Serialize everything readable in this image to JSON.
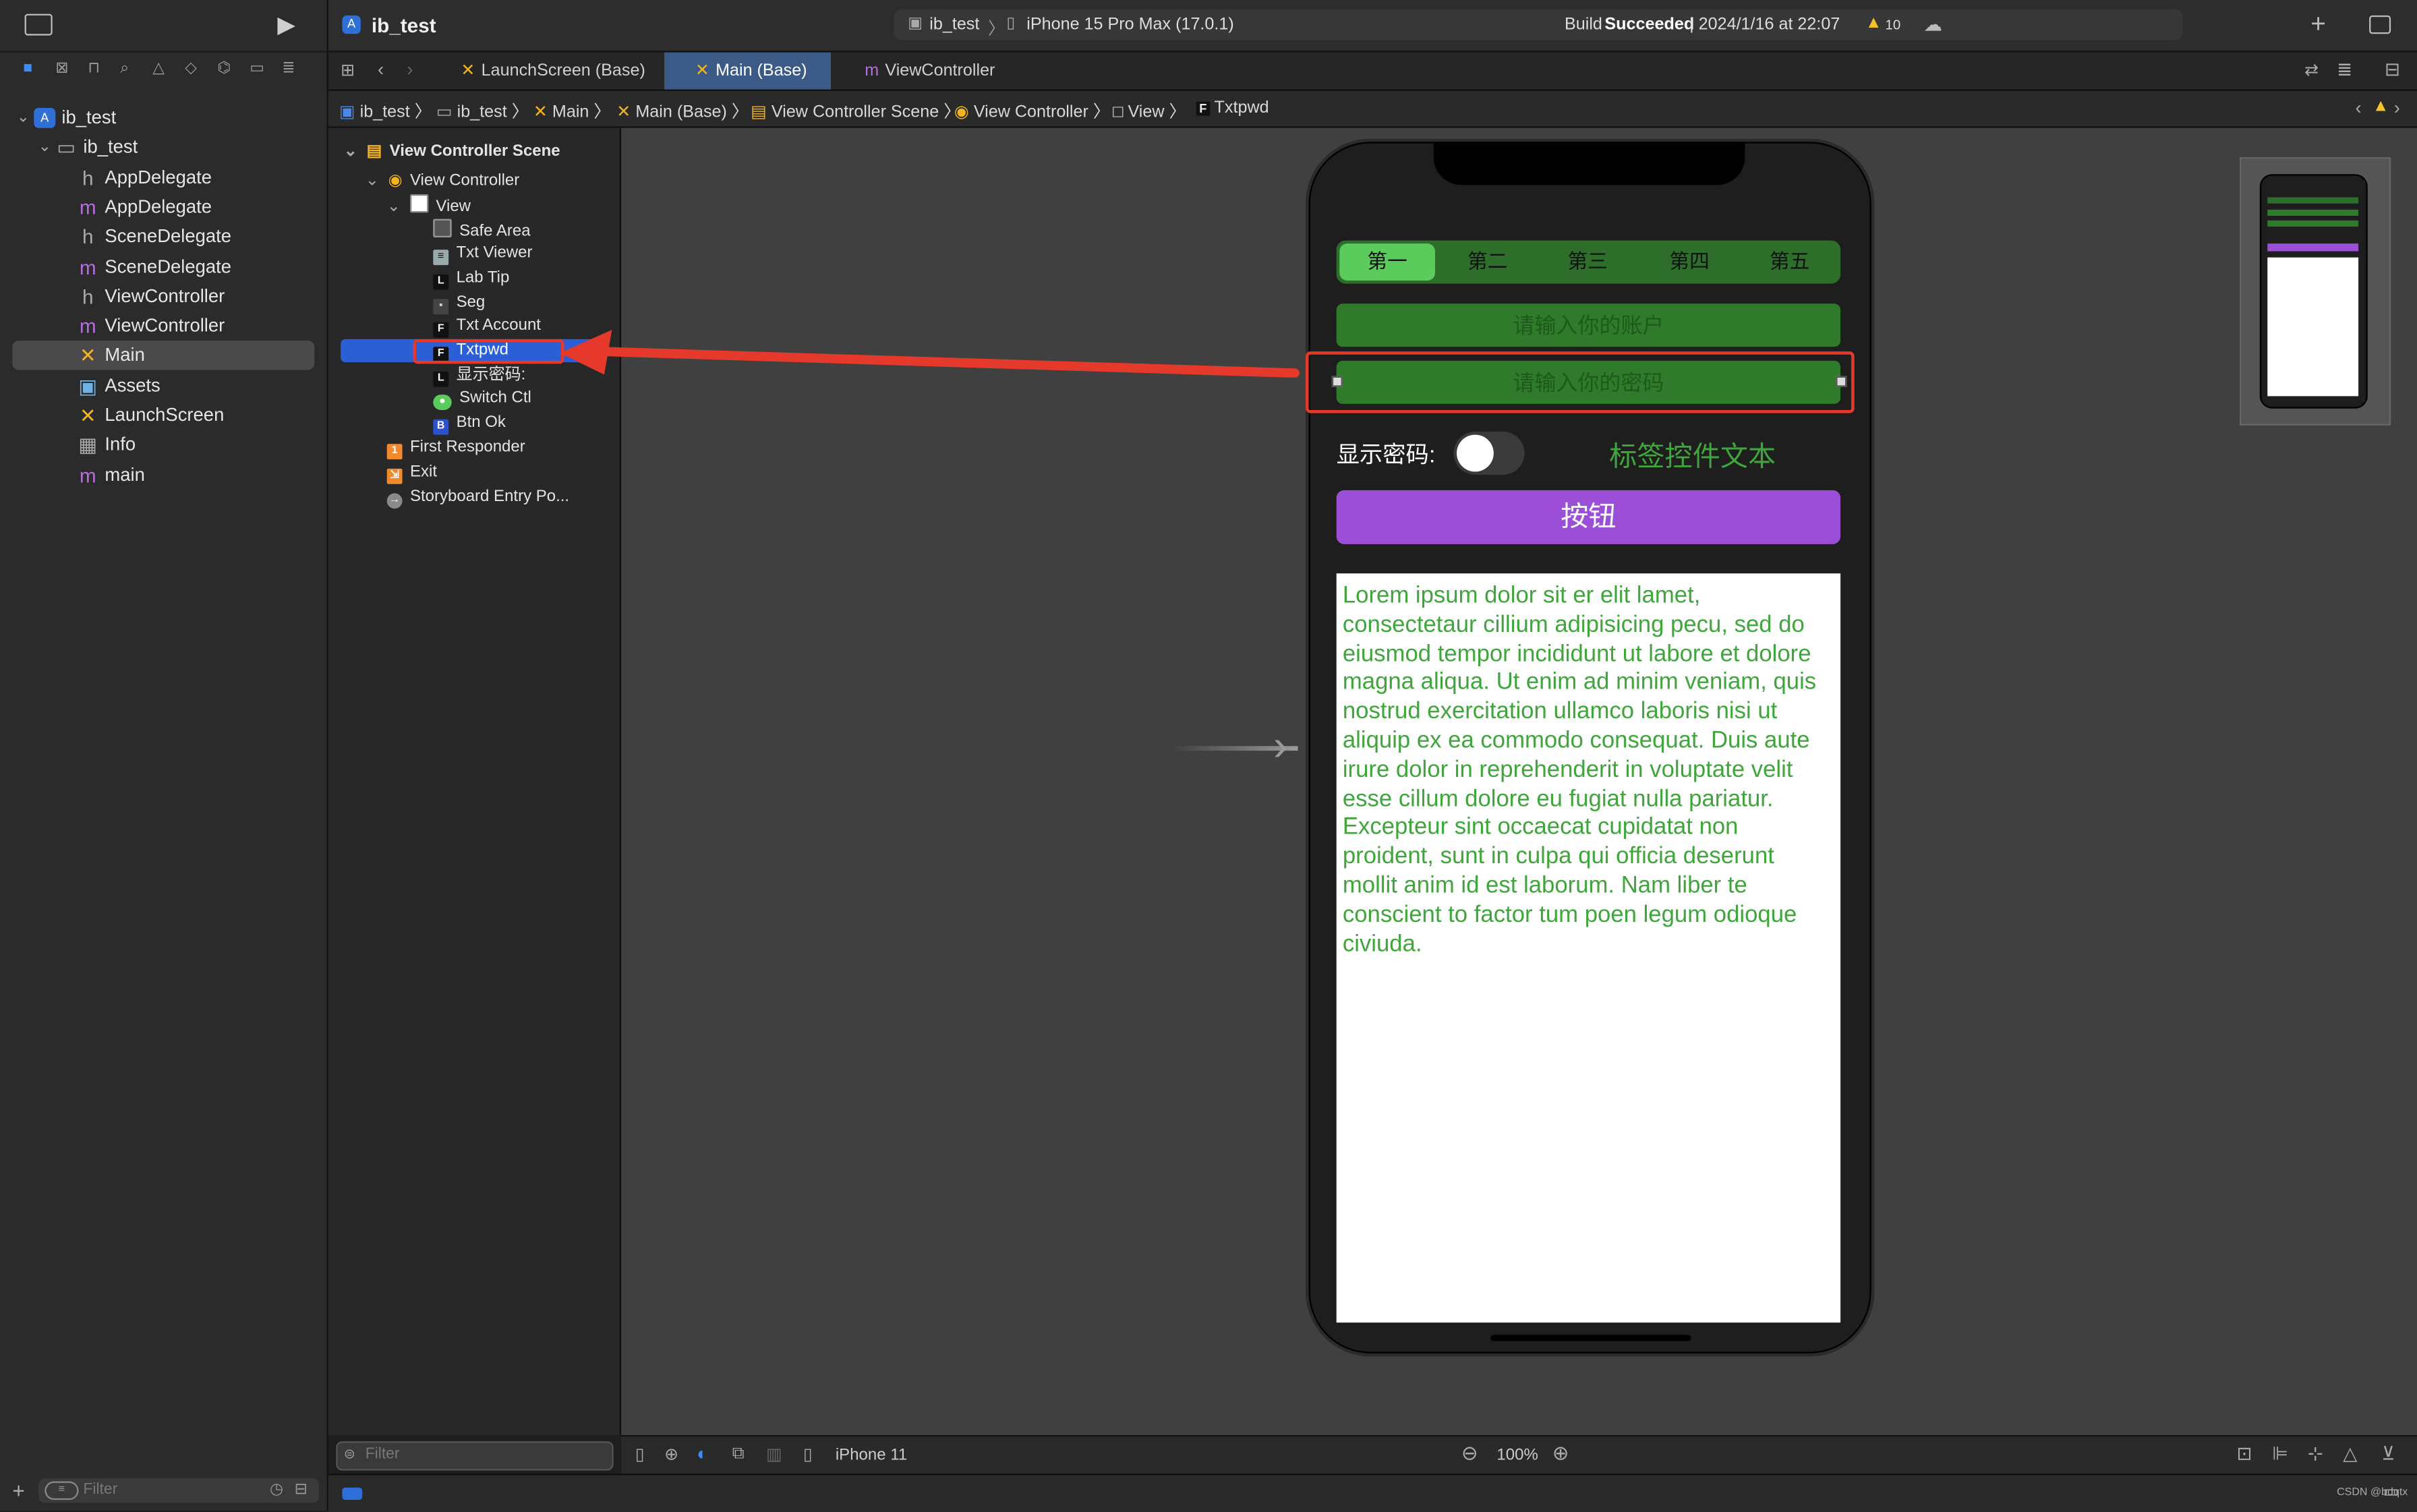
{
  "project": "ib_test",
  "toolbar": {
    "scheme": "ib_test",
    "device": "iPhone 15 Pro Max (17.0.1)",
    "build_prefix": "Build",
    "build_status": "Succeeded",
    "build_time": "| 2024/1/16 at 22:07",
    "warning_count": "10"
  },
  "navigator": {
    "items": [
      {
        "label": "ib_test",
        "icon": "A"
      },
      {
        "label": "ib_test",
        "icon": "▭"
      },
      {
        "label": "AppDelegate",
        "icon": "h"
      },
      {
        "label": "AppDelegate",
        "icon": "m"
      },
      {
        "label": "SceneDelegate",
        "icon": "h"
      },
      {
        "label": "SceneDelegate",
        "icon": "m"
      },
      {
        "label": "ViewController",
        "icon": "h"
      },
      {
        "label": "ViewController",
        "icon": "m"
      },
      {
        "label": "Main",
        "icon": "✕"
      },
      {
        "label": "Assets",
        "icon": "▣"
      },
      {
        "label": "LaunchScreen",
        "icon": "✕"
      },
      {
        "label": "Info",
        "icon": "▦"
      },
      {
        "label": "main",
        "icon": "m"
      }
    ],
    "filter_placeholder": "Filter"
  },
  "tabs": [
    {
      "label": "LaunchScreen (Base)"
    },
    {
      "label": "Main (Base)"
    },
    {
      "label": "ViewController"
    }
  ],
  "jumpbar": [
    "ib_test",
    "ib_test",
    "Main",
    "Main (Base)",
    "View Controller Scene",
    "View Controller",
    "View",
    "Txtpwd"
  ],
  "outline": {
    "scene": "View Controller Scene",
    "vc": "View Controller",
    "view": "View",
    "children": [
      {
        "label": "Safe Area",
        "badge": ""
      },
      {
        "label": "Txt Viewer",
        "badge": "≡"
      },
      {
        "label": "Lab Tip",
        "badge": "L"
      },
      {
        "label": "Seg",
        "badge": "▪"
      },
      {
        "label": "Txt Account",
        "badge": "F"
      },
      {
        "label": "Txtpwd",
        "badge": "F"
      },
      {
        "label": "显示密码:",
        "badge": "L"
      },
      {
        "label": "Switch Ctl",
        "badge": "●"
      },
      {
        "label": "Btn Ok",
        "badge": "B"
      }
    ],
    "first_responder": "First Responder",
    "exit": "Exit",
    "entry": "Storyboard Entry Po...",
    "filter_placeholder": "Filter"
  },
  "phone": {
    "segments": [
      "第一",
      "第二",
      "第三",
      "第四",
      "第五"
    ],
    "account_placeholder": "请输入你的账户",
    "password_placeholder": "请输入你的密码",
    "show_pwd_label": "显示密码:",
    "tip_label": "标签控件文本",
    "button": "按钮",
    "text": "Lorem ipsum dolor sit er elit lamet, consectetaur cillium adipisicing pecu, sed do eiusmod tempor incididunt ut labore et dolore magna aliqua. Ut enim ad minim veniam, quis nostrud exercitation ullamco laboris nisi ut aliquip ex ea commodo consequat. Duis aute irure dolor in reprehenderit in voluptate velit esse cillum dolore eu fugiat nulla pariatur. Excepteur sint occaecat cupidatat non proident, sunt in culpa qui officia deserunt mollit anim id est laborum. Nam liber te conscient to factor tum poen legum odioque civiuda."
  },
  "bottom": {
    "device": "iPhone 11",
    "zoom": "100%"
  },
  "watermark": "CSDN @bdqtx",
  "colors": {
    "selection": "#2a5fd6",
    "annotation": "#e5392c",
    "segment_bg": "#2d6e2b",
    "segment_on": "#5bcb5b",
    "button": "#9b4fd6",
    "text_green": "#3ea63a"
  }
}
